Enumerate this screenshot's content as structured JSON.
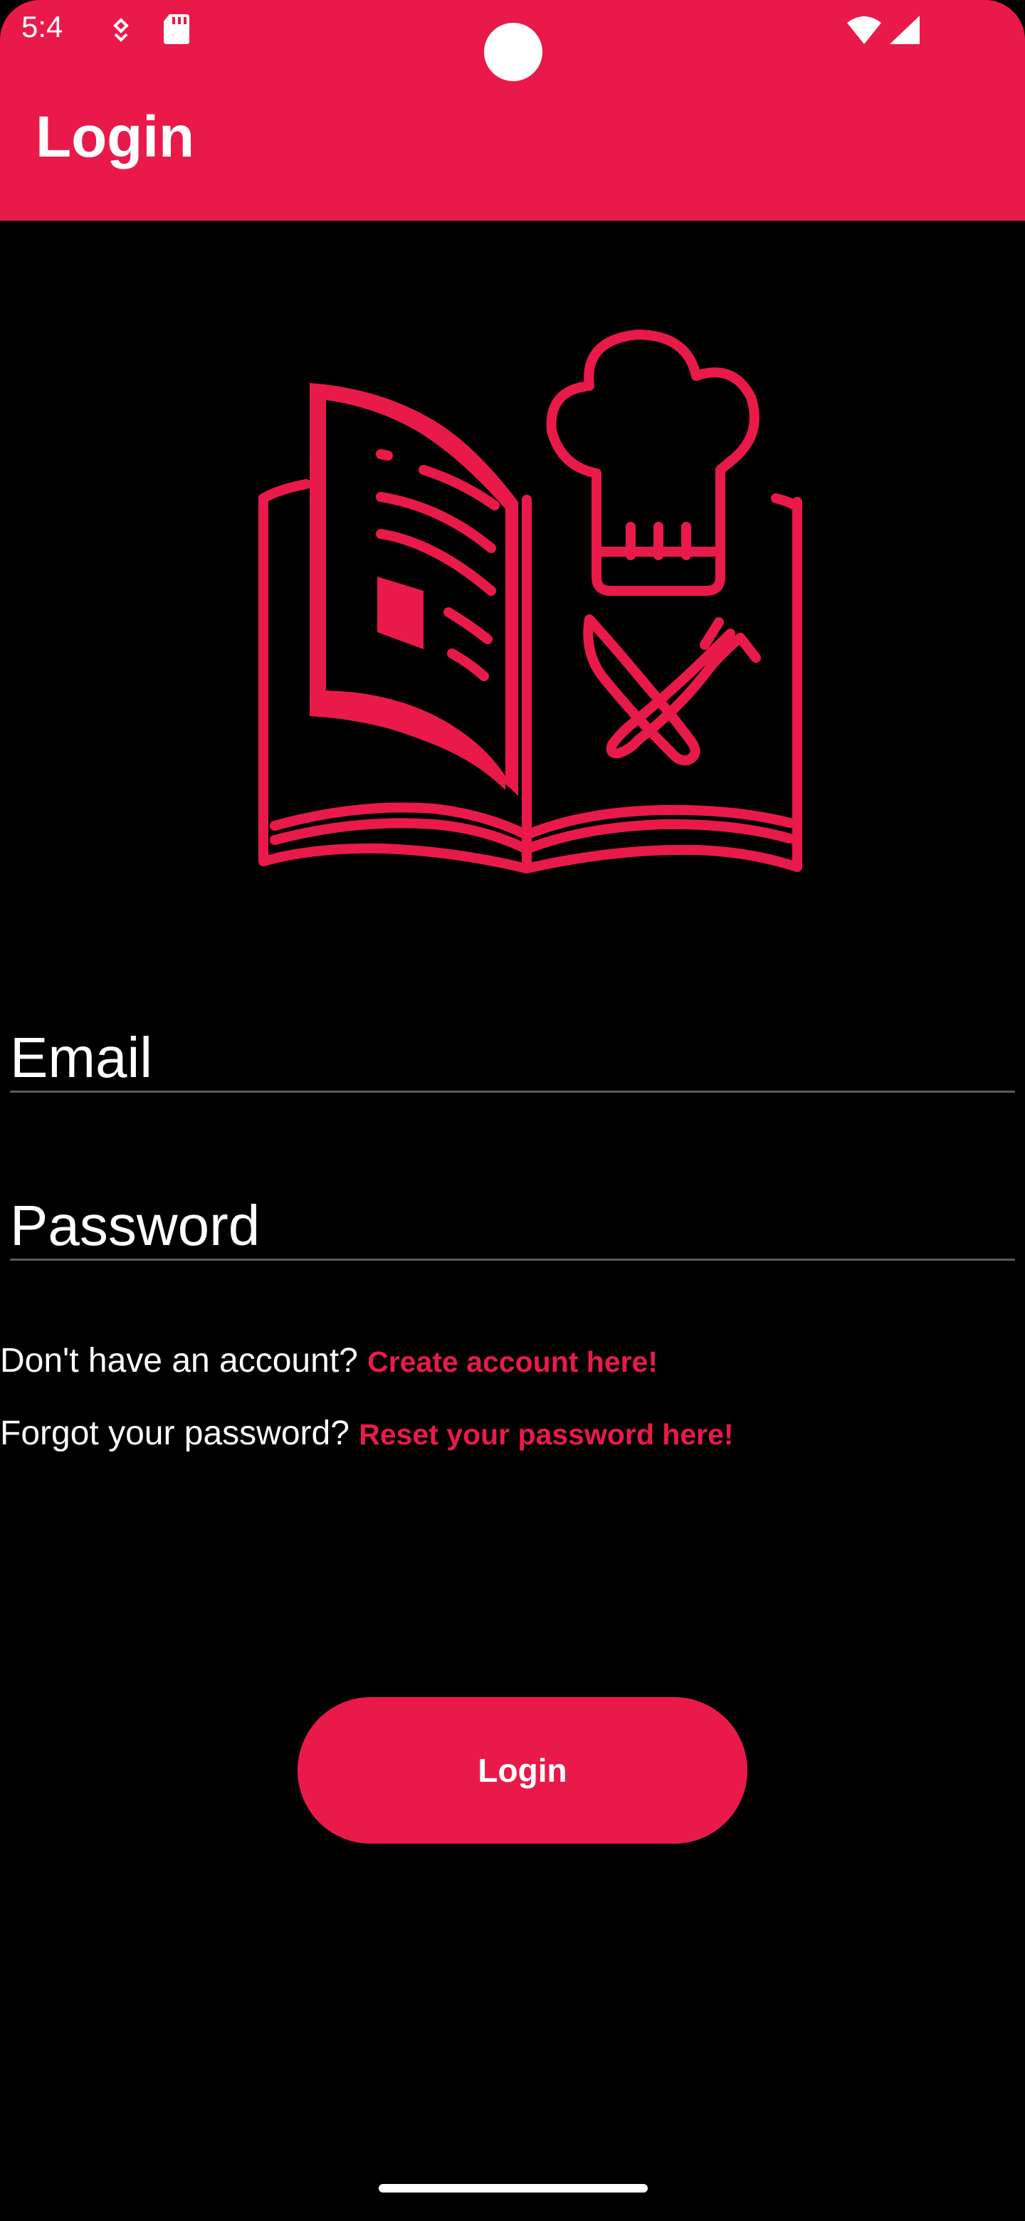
{
  "status_bar": {
    "time": "5:4",
    "icons": [
      "notification-icon",
      "sd-card-icon",
      "wifi-icon",
      "signal-icon"
    ]
  },
  "app_bar": {
    "title": "Login",
    "color": "#E91A4A"
  },
  "logo": {
    "icon": "recipe-book-chef-hat-icon",
    "color": "#E91A4A"
  },
  "form": {
    "email_placeholder": "Email",
    "password_placeholder": "Password"
  },
  "signup": {
    "prompt": "Don't have an account? ",
    "link": "Create account here!"
  },
  "reset": {
    "prompt": "Forgot your password? ",
    "link": "Reset your password here!"
  },
  "login_button": {
    "label": "Login"
  }
}
